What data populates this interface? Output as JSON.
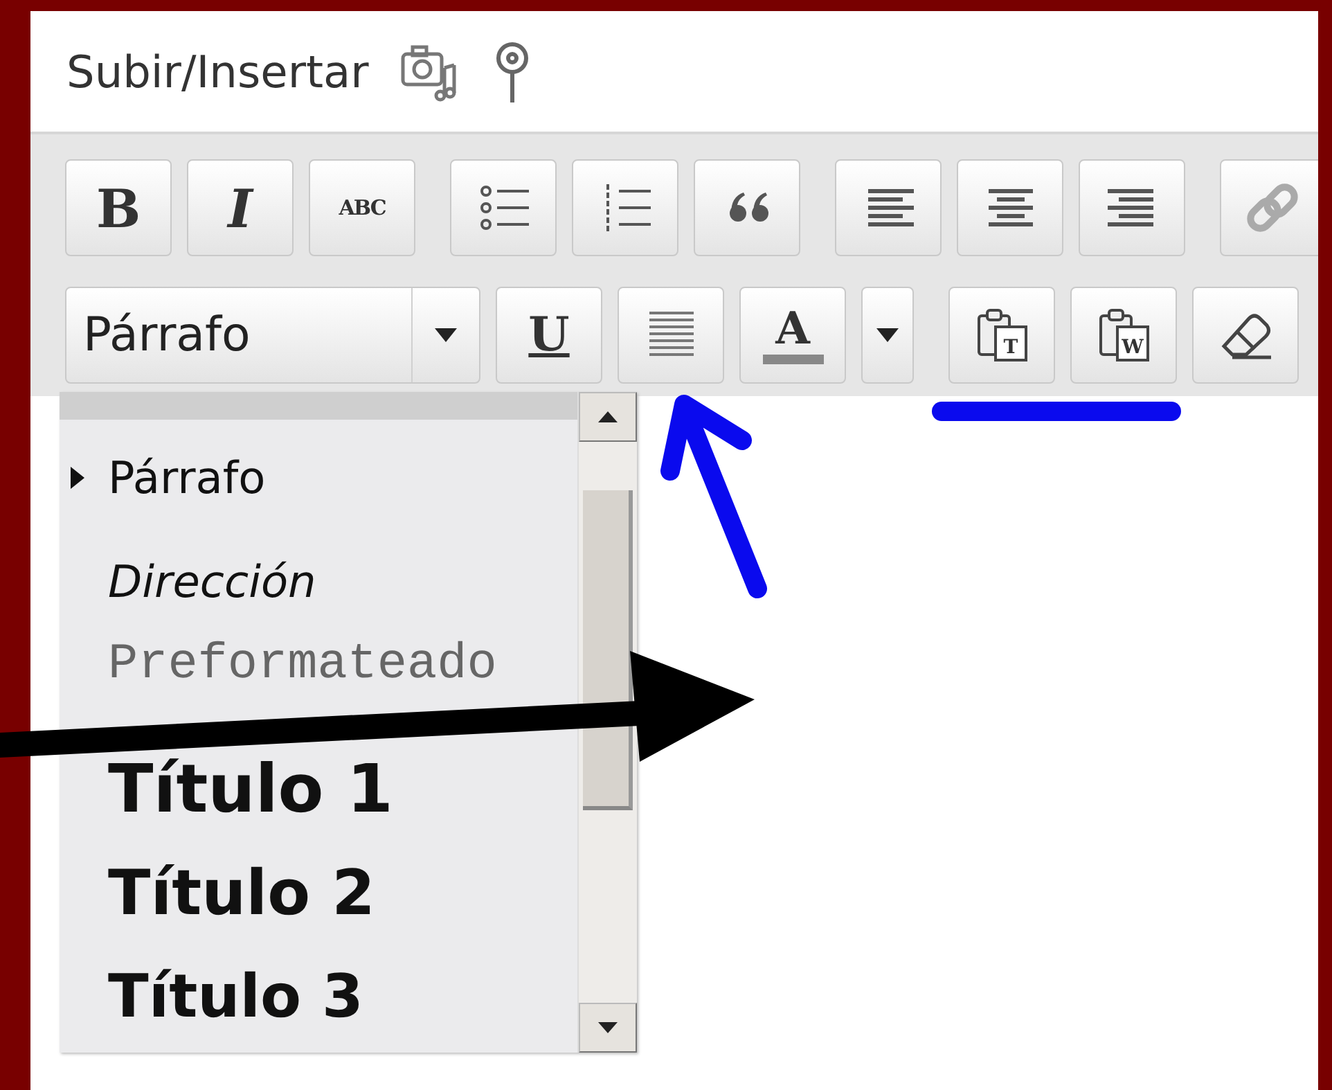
{
  "header": {
    "label": "Subir/Insertar"
  },
  "toolbar": {
    "rows": [
      {
        "groups": [
          [
            {
              "kind": "bold",
              "label": "B"
            },
            {
              "kind": "italic",
              "label": "I"
            },
            {
              "kind": "strike",
              "label": "ABC"
            }
          ],
          [
            {
              "kind": "bullets"
            },
            {
              "kind": "numbers"
            },
            {
              "kind": "quote"
            }
          ],
          [
            {
              "kind": "alignleft"
            },
            {
              "kind": "aligncenter"
            },
            {
              "kind": "alignright"
            }
          ],
          [
            {
              "kind": "link"
            }
          ]
        ]
      },
      {
        "groups": [
          [
            {
              "kind": "format",
              "value": "Párrafo"
            },
            {
              "kind": "underline",
              "label": "U"
            },
            {
              "kind": "justify"
            },
            {
              "kind": "textcolor",
              "label": "A"
            },
            {
              "kind": "caret"
            }
          ],
          [
            {
              "kind": "pastetext",
              "label": "T"
            },
            {
              "kind": "pasteword",
              "label": "W"
            },
            {
              "kind": "eraser"
            }
          ]
        ]
      }
    ]
  },
  "format_menu": {
    "items": [
      {
        "kind": "paragraph",
        "label": "Párrafo",
        "selected": true
      },
      {
        "kind": "address",
        "label": "Dirección",
        "selected": false
      },
      {
        "kind": "pre",
        "label": "Preformateado",
        "selected": false
      },
      {
        "kind": "h1",
        "label": "Título 1",
        "selected": false
      },
      {
        "kind": "h2",
        "label": "Título 2",
        "selected": false
      },
      {
        "kind": "h3",
        "label": "Título 3",
        "selected": false
      }
    ]
  },
  "annotations": [
    {
      "kind": "arrow-up",
      "color": "#0a0aee"
    },
    {
      "kind": "underline",
      "color": "#0a0aee"
    },
    {
      "kind": "arrow-right",
      "color": "#000000"
    }
  ]
}
